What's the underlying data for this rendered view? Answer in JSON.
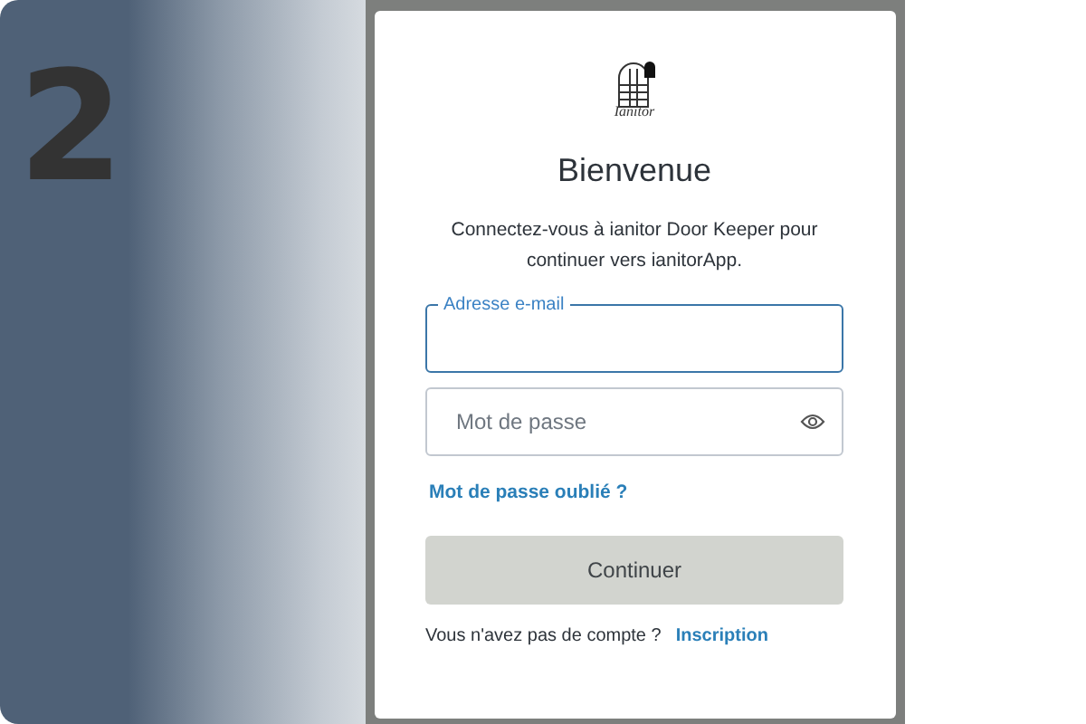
{
  "step_number": "2",
  "logo": {
    "text": "Ianitor"
  },
  "title": "Bienvenue",
  "subtitle": "Connectez-vous à ianitor Door Keeper pour continuer vers ianitorApp.",
  "fields": [
    {
      "kind": "email",
      "label": "Adresse e-mail",
      "focused": true
    },
    {
      "kind": "password",
      "placeholder": "Mot de passe",
      "focused": false
    }
  ],
  "forgot_link": "Mot de passe oublié ?",
  "submit": {
    "label": "Continuer",
    "disabled": true
  },
  "signup": {
    "prompt": "Vous n'avez pas de compte ?",
    "link": "Inscription"
  }
}
